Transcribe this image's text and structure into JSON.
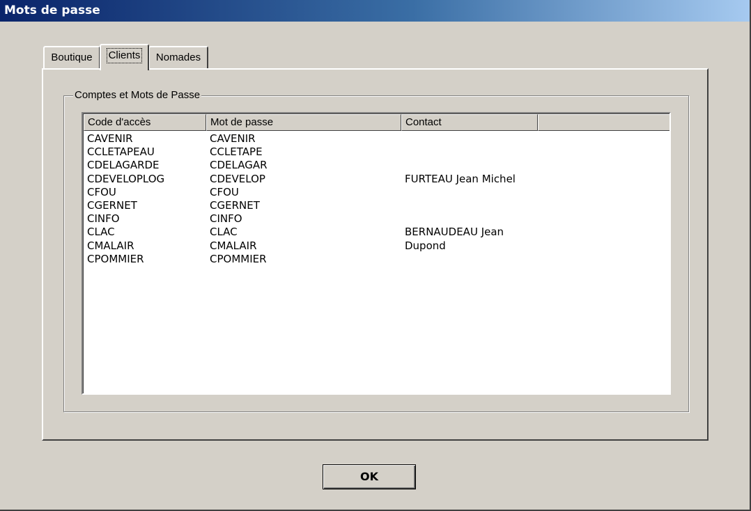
{
  "window": {
    "title": "Mots de passe"
  },
  "tabs": [
    {
      "label": "Boutique",
      "active": false
    },
    {
      "label": "Clients",
      "active": true
    },
    {
      "label": "Nomades",
      "active": false
    }
  ],
  "group": {
    "legend": "Comptes et Mots de Passe"
  },
  "list": {
    "columns": [
      "Code d'accès",
      "Mot de passe",
      "Contact",
      ""
    ],
    "rows": [
      [
        "CAVENIR",
        "CAVENIR",
        ""
      ],
      [
        "CCLETAPEAU",
        "CCLETAPE",
        ""
      ],
      [
        "CDELAGARDE",
        "CDELAGAR",
        ""
      ],
      [
        "CDEVELOPLOG",
        "CDEVELOP",
        "FURTEAU Jean Michel"
      ],
      [
        "CFOU",
        "CFOU",
        ""
      ],
      [
        "CGERNET",
        "CGERNET",
        ""
      ],
      [
        "CINFO",
        "CINFO",
        ""
      ],
      [
        "CLAC",
        "CLAC",
        "BERNAUDEAU Jean"
      ],
      [
        "CMALAIR",
        "CMALAIR",
        "Dupond"
      ],
      [
        "CPOMMIER",
        "CPOMMIER",
        ""
      ]
    ]
  },
  "buttons": {
    "ok_label": "OK"
  }
}
